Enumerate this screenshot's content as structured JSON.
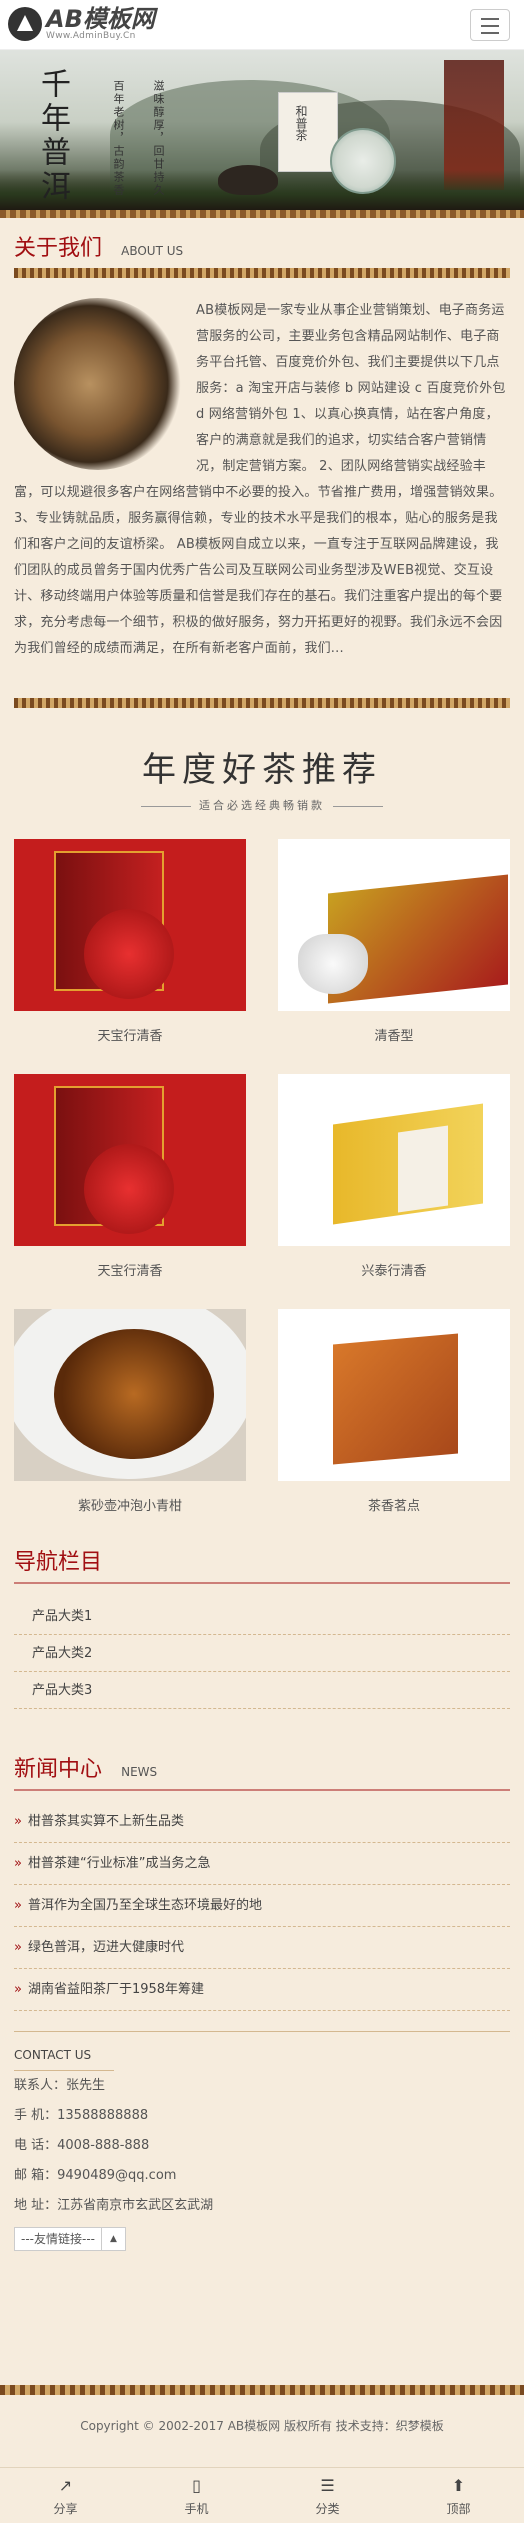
{
  "header": {
    "logo_main": "AB模板网",
    "logo_sub": "Www.AdminBuy.Cn",
    "menu_icon": "hamburger-icon"
  },
  "banner": {
    "title": "千年普洱",
    "line1": "百年老树，古韵茶香",
    "line2": "滋味醇厚，回甘持久",
    "card": "和普茶"
  },
  "about": {
    "title_cn": "关于我们",
    "title_en": "ABOUT US",
    "text": "AB模板网是一家专业从事企业营销策划、电子商务运营服务的公司，主要业务包含精品网站制作、电子商务平台托管、百度竞价外包、我们主要提供以下几点服务：a 淘宝开店与装修 b 网站建设 c 百度竞价外包 d 网络营销外包 1、以真心换真情，站在客户角度，客户的满意就是我们的追求，切实结合客户营销情况，制定营销方案。 2、团队网络营销实战经验丰富，可以规避很多客户在网络营销中不必要的投入。节省推广费用，增强营销效果。 3、专业铸就品质，服务赢得信赖，专业的技术水平是我们的根本，贴心的服务是我们和客户之间的友谊桥梁。 AB模板网自成立以来，一直专注于互联网品牌建设，我们团队的成员曾务于国内优秀广告公司及互联网公司业务型涉及WEB视觉、交互设计、移动终端用户体验等质量和信誉是我们存在的基石。我们注重客户提出的每个要求，充分考虑每一个细节，积极的做好服务，努力开拓更好的视野。我们永远不会因为我们曾经的成绩而满足，在所有新老客户面前，我们..."
  },
  "tea": {
    "title": "年度好茶推荐",
    "subtitle": "适合必选经典畅销款",
    "products": [
      {
        "name": "天宝行清香",
        "style": "red"
      },
      {
        "name": "清香型",
        "style": "white"
      },
      {
        "name": "天宝行清香",
        "style": "red"
      },
      {
        "name": "兴泰行清香",
        "style": "yellow"
      },
      {
        "name": "紫砂壶冲泡小青柑",
        "style": "bowl"
      },
      {
        "name": "茶香茗点",
        "style": "orange"
      }
    ]
  },
  "nav": {
    "title": "导航栏目",
    "items": [
      "产品大类1",
      "产品大类2",
      "产品大类3"
    ]
  },
  "news": {
    "title_cn": "新闻中心",
    "title_en": "NEWS",
    "items": [
      "柑普茶其实算不上新生品类",
      "柑普茶建“行业标准”成当务之急",
      "普洱作为全国乃至全球生态环境最好的地",
      "绿色普洱，迈进大健康时代",
      "湖南省益阳茶厂于1958年筹建"
    ]
  },
  "contact": {
    "title": "CONTACT US",
    "person": "联系人：张先生",
    "mobile": "手 机：13588888888",
    "phone": "电 话：4008-888-888",
    "email": "邮 箱：9490489@qq.com",
    "address": "地 址：江苏省南京市玄武区玄武湖",
    "friend_link": "---友情链接---"
  },
  "footer": {
    "copyright": "Copyright © 2002-2017 AB模板网 版权所有 技术支持：织梦模板"
  },
  "bottom_bar": [
    {
      "label": "分享",
      "icon": "share-icon"
    },
    {
      "label": "手机",
      "icon": "mobile-icon"
    },
    {
      "label": "分类",
      "icon": "category-icon"
    },
    {
      "label": "顶部",
      "icon": "top-icon"
    }
  ]
}
